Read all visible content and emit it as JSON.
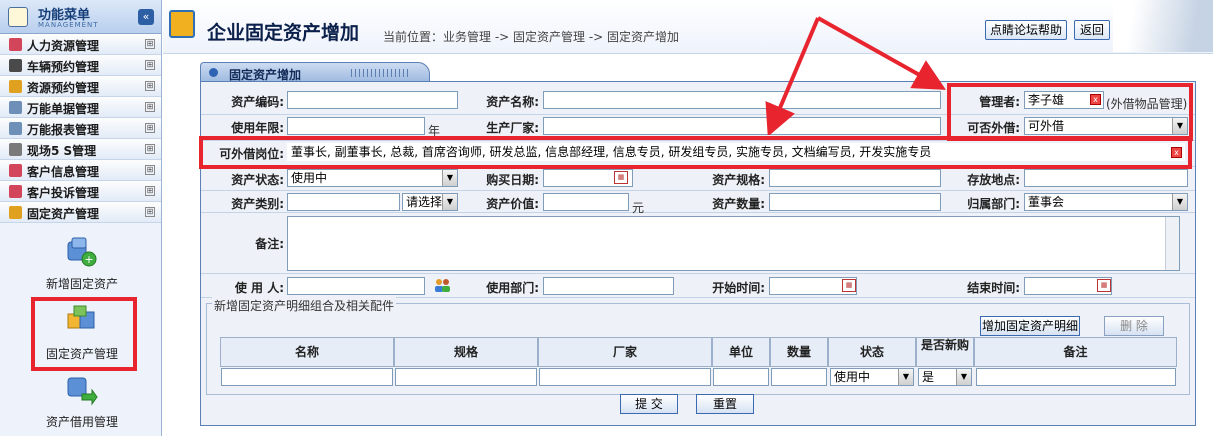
{
  "sidebar": {
    "title": "功能菜单",
    "subtitle": "MANAGEMENT",
    "collapse_glyph": "«",
    "items": [
      {
        "label": "人力资源管理",
        "icon": "people-icon",
        "color": "#d2455a"
      },
      {
        "label": "车辆预约管理",
        "icon": "car-icon",
        "color": "#4a4a4a"
      },
      {
        "label": "资源预约管理",
        "icon": "resource-icon",
        "color": "#e0a020"
      },
      {
        "label": "万能单据管理",
        "icon": "document-icon",
        "color": "#6d8fb8"
      },
      {
        "label": "万能报表管理",
        "icon": "report-icon",
        "color": "#6d8fb8"
      },
      {
        "label": "现场5 S管理",
        "icon": "gear-icon",
        "color": "#7a7a7a"
      },
      {
        "label": "客户信息管理",
        "icon": "customer-icon",
        "color": "#d2455a"
      },
      {
        "label": "客户投诉管理",
        "icon": "complaint-icon",
        "color": "#d2455a"
      },
      {
        "label": "固定资产管理",
        "icon": "asset-icon",
        "color": "#e0a020"
      }
    ],
    "toggle_glyph": "⊞",
    "subitems": [
      {
        "label": "新增固定资产",
        "icon": "add-asset-icon"
      },
      {
        "label": "固定资产管理",
        "icon": "asset-manage-icon"
      },
      {
        "label": "资产借用管理",
        "icon": "asset-borrow-icon"
      }
    ]
  },
  "header": {
    "title": "企业固定资产增加",
    "location": "当前位置：业务管理 -> 固定资产管理 -> 固定资产增加",
    "help_button": "点睛论坛帮助",
    "back_button": "返回"
  },
  "panel": {
    "tab_title": "固定资产增加"
  },
  "form": {
    "asset_code_label": "资产编码:",
    "asset_code_value": "",
    "asset_name_label": "资产名称:",
    "asset_name_value": "",
    "manager_label": "管理者:",
    "manager_value": "李子雄",
    "manager_note": "(外借物品管理)",
    "years_label": "使用年限:",
    "years_unit": "年",
    "maker_label": "生产厂家:",
    "lendable_label": "可否外借:",
    "lendable_value": "可外借",
    "positions_label": "可外借岗位:",
    "positions_value": "董事长, 副董事长, 总裁, 首席咨询师, 研发总监, 信息部经理, 信息专员, 研发组专员, 实施专员, 文档编写员, 开发实施专员",
    "status_label": "资产状态:",
    "status_value": "使用中",
    "buy_date_label": "购买日期:",
    "spec_label": "资产规格:",
    "place_label": "存放地点:",
    "category_label": "资产类别:",
    "category_select": "请选择",
    "value_label": "资产价值:",
    "value_unit": "元",
    "qty_label": "资产数量:",
    "dept_label": "归属部门:",
    "dept_value": "董事会",
    "remark_label": "备注:",
    "user_label": "使 用 人:",
    "use_dept_label": "使用部门:",
    "start_label": "开始时间:",
    "end_label": "结束时间:"
  },
  "detail": {
    "legend": "新增固定资产明细组合及相关配件",
    "add_button": "增加固定资产明细",
    "delete_button": "删 除",
    "columns": [
      "名称",
      "规格",
      "厂家",
      "单位",
      "数量",
      "状态",
      "是否新购",
      "备注"
    ],
    "row_status": "使用中",
    "row_new": "是"
  },
  "footer": {
    "submit_button": "提 交",
    "reset_button": "重置"
  },
  "colors": {
    "annotation_red": "#e8242e",
    "accent_blue": "#2f64b3"
  }
}
